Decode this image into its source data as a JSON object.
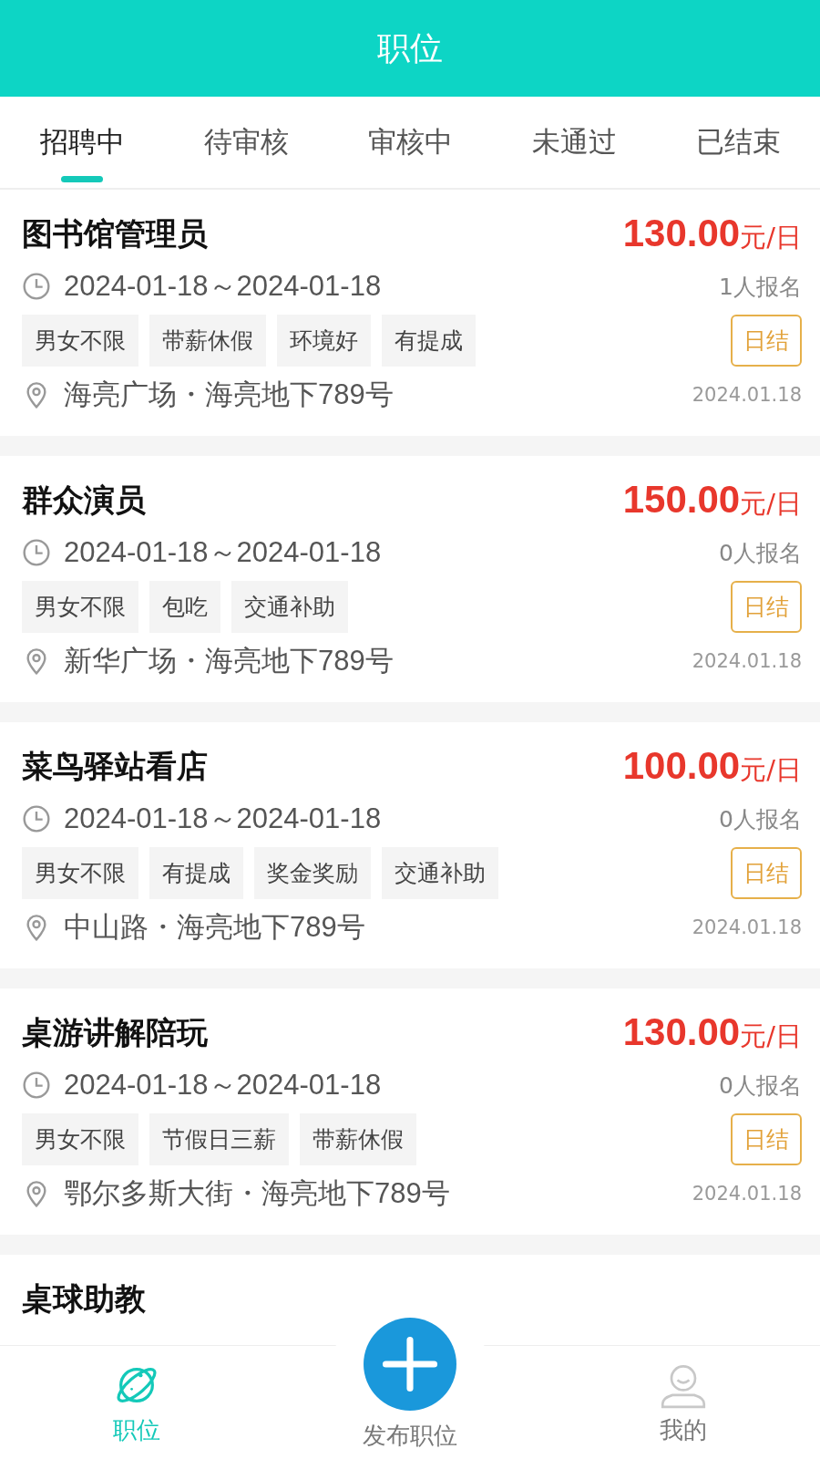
{
  "header": {
    "title": "职位"
  },
  "tabs": [
    {
      "label": "招聘中",
      "selected": true
    },
    {
      "label": "待审核",
      "selected": false
    },
    {
      "label": "审核中",
      "selected": false
    },
    {
      "label": "未通过",
      "selected": false
    },
    {
      "label": "已结束",
      "selected": false
    }
  ],
  "jobs": [
    {
      "title": "图书馆管理员",
      "price": "130.00",
      "unit": "元/日",
      "dates": "2024-01-18～2024-01-18",
      "signups": "1人报名",
      "tags": [
        "男女不限",
        "带薪休假",
        "环境好",
        "有提成"
      ],
      "settlement": "日结",
      "location": "海亮广场・海亮地下789号",
      "posted": "2024.01.18"
    },
    {
      "title": "群众演员",
      "price": "150.00",
      "unit": "元/日",
      "dates": "2024-01-18～2024-01-18",
      "signups": "0人报名",
      "tags": [
        "男女不限",
        "包吃",
        "交通补助"
      ],
      "settlement": "日结",
      "location": "新华广场・海亮地下789号",
      "posted": "2024.01.18"
    },
    {
      "title": "菜鸟驿站看店",
      "price": "100.00",
      "unit": "元/日",
      "dates": "2024-01-18～2024-01-18",
      "signups": "0人报名",
      "tags": [
        "男女不限",
        "有提成",
        "奖金奖励",
        "交通补助"
      ],
      "settlement": "日结",
      "location": "中山路・海亮地下789号",
      "posted": "2024.01.18"
    },
    {
      "title": "桌游讲解陪玩",
      "price": "130.00",
      "unit": "元/日",
      "dates": "2024-01-18～2024-01-18",
      "signups": "0人报名",
      "tags": [
        "男女不限",
        "节假日三薪",
        "带薪休假"
      ],
      "settlement": "日结",
      "location": "鄂尔多斯大街・海亮地下789号",
      "posted": "2024.01.18"
    }
  ],
  "partial_job": {
    "title": "桌球助教"
  },
  "bottom_nav": [
    {
      "kind": "planet",
      "label": "职位",
      "selected": true
    },
    {
      "kind": "add",
      "label": "发布职位",
      "selected": false
    },
    {
      "kind": "person",
      "label": "我的",
      "selected": false
    }
  ]
}
